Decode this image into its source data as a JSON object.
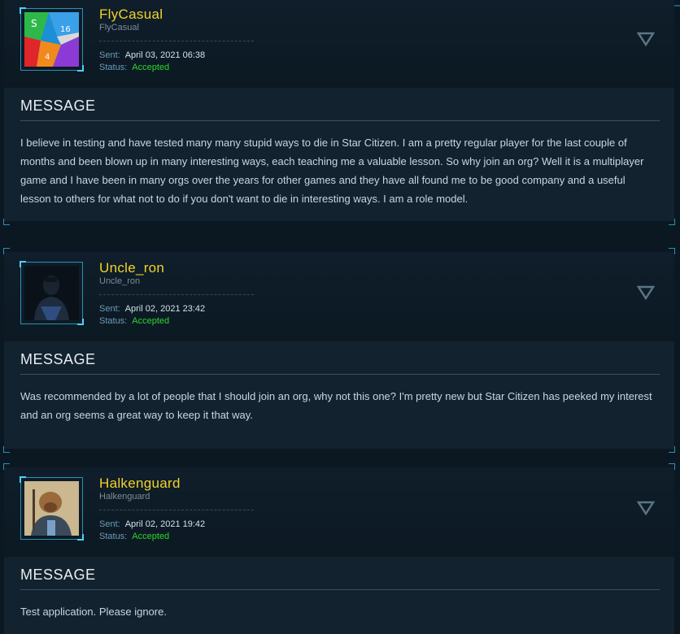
{
  "applications": [
    {
      "username": "FlyCasual",
      "handle": "FlyCasual",
      "sent_label": "Sent:",
      "sent": "April 03, 2021 06:38",
      "status_label": "Status:",
      "status": "Accepted",
      "message_heading": "MESSAGE",
      "message": "I believe in testing and have tested many many stupid ways to die in Star Citizen. I am a pretty regular player for the last couple of months and been blown up in many interesting ways, each teaching me a valuable lesson. So why join an org? Well it is a multiplayer game and I have been in many orgs over the years for other games and they have all found me to be good company and a useful lesson to others for what not to do if you don't want to die in interesting ways. I am a role model."
    },
    {
      "username": "Uncle_ron",
      "handle": "Uncle_ron",
      "sent_label": "Sent:",
      "sent": "April 02, 2021 23:42",
      "status_label": "Status:",
      "status": "Accepted",
      "message_heading": "MESSAGE",
      "message": "Was recommended by a lot of people that I should join an org, why not this one? I'm pretty new but Star Citizen has peeked my interest and an org seems a great way to keep it that way."
    },
    {
      "username": "Halkenguard",
      "handle": "Halkenguard",
      "sent_label": "Sent:",
      "sent": "April 02, 2021 19:42",
      "status_label": "Status:",
      "status": "Accepted",
      "message_heading": "MESSAGE",
      "message": "Test application. Please ignore."
    }
  ],
  "colors": {
    "username": "#f2d22a",
    "accepted": "#2dd62d",
    "accent": "#2a91b5"
  }
}
